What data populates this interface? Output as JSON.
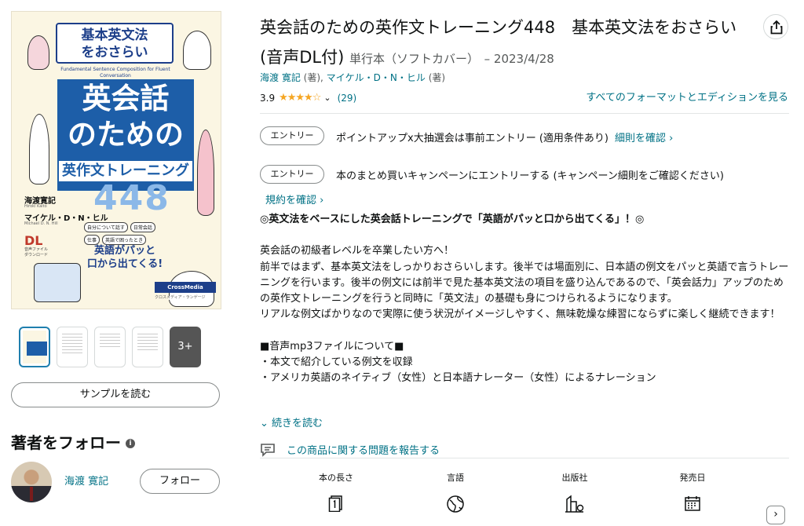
{
  "cover": {
    "title_top": "基本英文法\nをおさらい",
    "subtitle_en": "Fundamental Sentence Composition for Fluent Conversation",
    "title_main": "英会話\nのための",
    "title_sub": "英作文トレーニング",
    "number": "448",
    "author1": "海渡寛記",
    "author1_en": "Hiroki Kaito",
    "author2": "マイケル・D・N・ヒル",
    "author2_en": "Michael D. N. Hill",
    "tags": [
      "自分について話す",
      "日常会話",
      "仕事",
      "英語で困ったとき"
    ],
    "dl": "DL",
    "dl_sub": "音声ファイル ダウンロード",
    "catch": "英語がパッと\n口から出てくる!",
    "publisher": "CrossMedia LANGUAGE",
    "publisher_kana": "クロスメディア・ランゲージ"
  },
  "thumbnails": {
    "more_label": "3+"
  },
  "sample_button": "サンプルを読む",
  "follow": {
    "heading": "著者をフォロー",
    "info_icon": "i",
    "author_name": "海渡 寛記",
    "button": "フォロー"
  },
  "product": {
    "title": "英会話のための英作文トレーニング448　基本英文法をおさらい (音声DL付)",
    "format": "単行本（ソフトカバー）",
    "date": "– 2023/4/28",
    "author1": "海渡 寛記",
    "author1_role": "(著),",
    "author2": "マイケル・D・N・ヒル",
    "author2_role": "(著)",
    "rating": "3.9",
    "stars": "★★★★☆",
    "rating_count": "(29)",
    "formats_link": "すべてのフォーマットとエディションを見る"
  },
  "entries": [
    {
      "pill": "エントリー",
      "text": "ポイントアップx大抽選会は事前エントリー (適用条件あり)",
      "link": "細則を確認 ›"
    },
    {
      "pill": "エントリー",
      "text": "本のまとめ買いキャンペーンにエントリーする (キャンペーン細則をご確認ください)",
      "link": ""
    }
  ],
  "rules_link": "規約を確認 ›",
  "description": {
    "lead": "◎英文法をベースにした英会話トレーニングで「英語がパッと口から出てくる」！◎",
    "paragraphs": [
      "英会話の初級者レベルを卒業したい方へ！",
      "前半ではまず、基本英文法をしっかりおさらいします。後半では場面別に、日本語の例文をパッと英語で言うトレーニングを行います。後半の例文には前半で見た基本英文法の項目を盛り込んであるので、「英会話力」アップのための英作文トレーニングを行うと同時に「英文法」の基礎も身につけられるようになります。",
      "リアルな例文ばかりなので実際に使う状況がイメージしやすく、無味乾燥な練習にならずに楽しく継続できます！",
      "",
      "■音声mp3ファイルについて■",
      "・本文で紹介している例文を収録",
      "・アメリカ英語のネイティブ（女性）と日本語ナレーター（女性）によるナレーション"
    ],
    "read_more": "続きを読む"
  },
  "report_link": "この商品に関する問題を報告する",
  "attributes": [
    {
      "label": "本の長さ",
      "icon": "page-count-icon"
    },
    {
      "label": "言語",
      "icon": "globe-icon"
    },
    {
      "label": "出版社",
      "icon": "building-icon"
    },
    {
      "label": "発売日",
      "icon": "calendar-icon"
    }
  ],
  "next_arrow": "›"
}
